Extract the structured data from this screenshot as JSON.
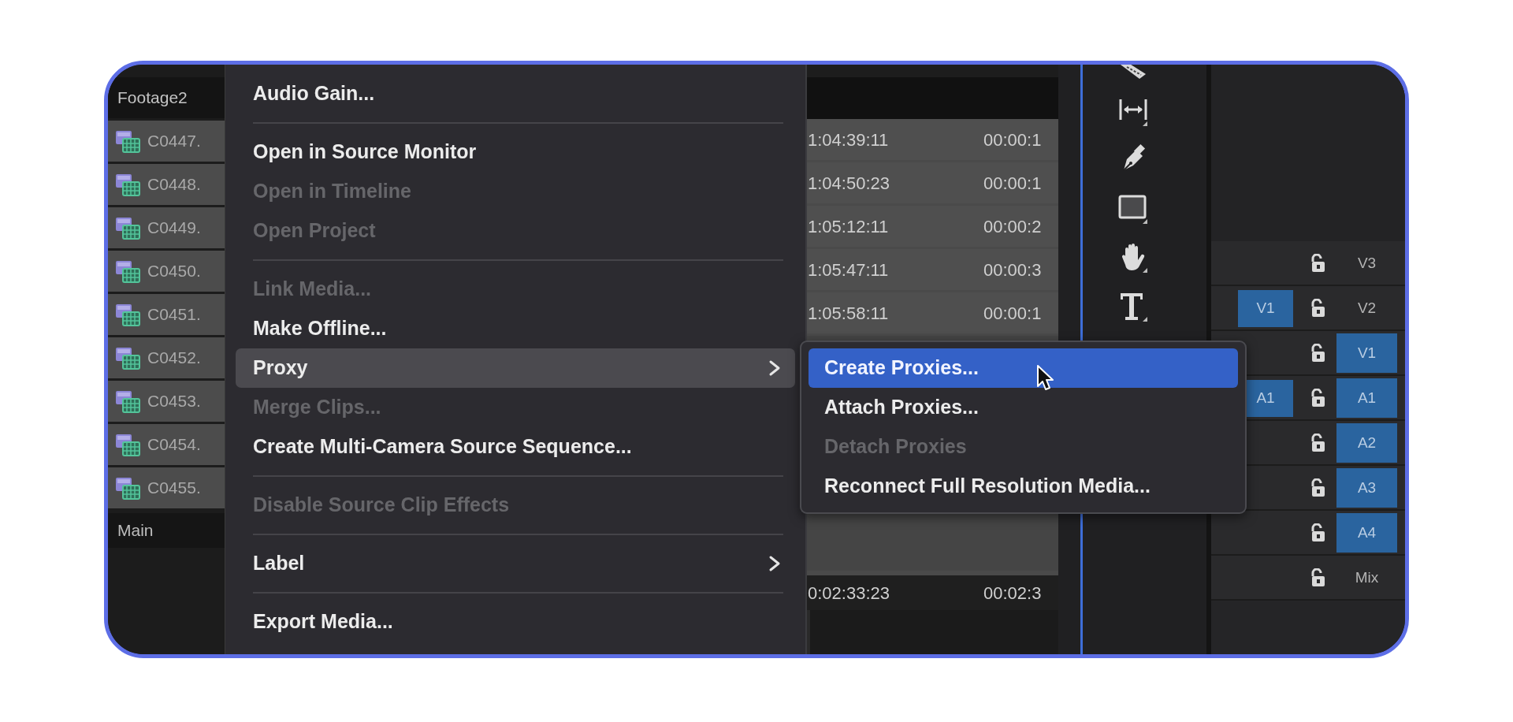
{
  "project_panel": {
    "bin": "Footage2",
    "clips": [
      {
        "name": "C0447."
      },
      {
        "name": "C0448."
      },
      {
        "name": "C0449."
      },
      {
        "name": "C0450."
      },
      {
        "name": "C0451."
      },
      {
        "name": "C0452."
      },
      {
        "name": "C0453."
      },
      {
        "name": "C0454."
      },
      {
        "name": "C0455."
      }
    ],
    "footer": "Main"
  },
  "context_menu": {
    "items": [
      {
        "kind": "item",
        "label": "Audio Gain...",
        "disabled": false,
        "highlighted": false
      },
      {
        "kind": "separator"
      },
      {
        "kind": "item",
        "label": "Open in Source Monitor",
        "disabled": false,
        "highlighted": false
      },
      {
        "kind": "item",
        "label": "Open in Timeline",
        "disabled": true,
        "highlighted": false
      },
      {
        "kind": "item",
        "label": "Open Project",
        "disabled": true,
        "highlighted": false
      },
      {
        "kind": "separator"
      },
      {
        "kind": "item",
        "label": "Link Media...",
        "disabled": true,
        "highlighted": false
      },
      {
        "kind": "item",
        "label": "Make Offline...",
        "disabled": false,
        "highlighted": false
      },
      {
        "kind": "submenu",
        "label": "Proxy",
        "disabled": false,
        "highlighted": true
      },
      {
        "kind": "item",
        "label": "Merge Clips...",
        "disabled": true,
        "highlighted": false
      },
      {
        "kind": "item",
        "label": "Create Multi-Camera Source Sequence...",
        "disabled": false,
        "highlighted": false
      },
      {
        "kind": "separator"
      },
      {
        "kind": "item",
        "label": "Disable Source Clip Effects",
        "disabled": true,
        "highlighted": false
      },
      {
        "kind": "separator"
      },
      {
        "kind": "submenu",
        "label": "Label",
        "disabled": false,
        "highlighted": false
      },
      {
        "kind": "separator"
      },
      {
        "kind": "item",
        "label": "Export Media...",
        "disabled": false,
        "highlighted": false
      }
    ]
  },
  "submenu": {
    "items": [
      {
        "label": "Create Proxies...",
        "disabled": false,
        "highlighted": true
      },
      {
        "label": "Attach Proxies...",
        "disabled": false,
        "highlighted": false
      },
      {
        "label": "Detach Proxies",
        "disabled": true,
        "highlighted": false
      },
      {
        "label": "Reconnect Full Resolution Media...",
        "disabled": false,
        "highlighted": false
      }
    ]
  },
  "timecodes": {
    "rows": [
      {
        "column_1": "1:04:39:11",
        "column_2": "00:00:1"
      },
      {
        "column_1": "1:04:50:23",
        "column_2": "00:00:1"
      },
      {
        "column_1": "1:05:12:11",
        "column_2": "00:00:2"
      },
      {
        "column_1": "1:05:47:11",
        "column_2": "00:00:3"
      },
      {
        "column_1": "1:05:58:11",
        "column_2": "00:00:1"
      }
    ],
    "footer_row": {
      "column_1": "0:02:33:23",
      "column_2": "00:02:3"
    }
  },
  "tracks": [
    {
      "label": "V3",
      "targeted": false
    },
    {
      "label": "V2",
      "targeted": false,
      "source_patch": "V1"
    },
    {
      "label": "V1",
      "targeted": true
    },
    {
      "label": "A1",
      "targeted": true,
      "source_patch": "A1"
    },
    {
      "label": "A2",
      "targeted": true
    },
    {
      "label": "A3",
      "targeted": true
    },
    {
      "label": "A4",
      "targeted": true
    },
    {
      "label": "Mix",
      "targeted": false
    }
  ]
}
